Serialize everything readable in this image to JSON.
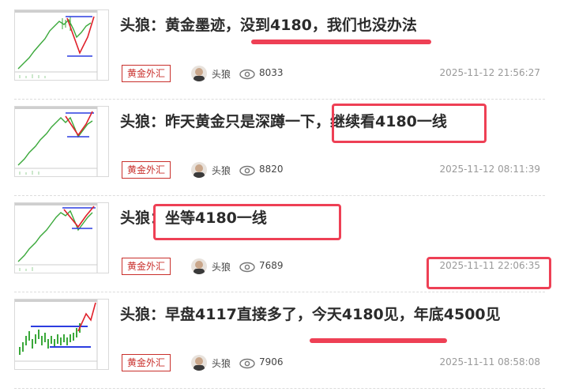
{
  "articles": [
    {
      "title": "头狼：黄金墨迹，没到4180，我们也没办法",
      "category": "黄金外汇",
      "author": "头狼",
      "views": "8033",
      "time": "2025-11-12 21:56:27"
    },
    {
      "title": "头狼：昨天黄金只是深蹲一下，继续看4180一线",
      "category": "黄金外汇",
      "author": "头狼",
      "views": "8820",
      "time": "2025-11-12 08:11:39"
    },
    {
      "title": "头狼：坐等4180一线",
      "category": "黄金外汇",
      "author": "头狼",
      "views": "7689",
      "time": "2025-11-11 22:06:35"
    },
    {
      "title": "头狼：早盘4117直接多了，今天4180见，年底4500见",
      "category": "黄金外汇",
      "author": "头狼",
      "views": "7906",
      "time": "2025-11-11 08:58:08"
    }
  ],
  "colors": {
    "annotation": "#ee4055",
    "tag": "#c9302c",
    "chart_up": "#3aa83a",
    "chart_line": "#2c3de0",
    "chart_arrow": "#e0202a"
  },
  "icons": [
    "eye-icon",
    "avatar",
    "chart-thumbnail"
  ]
}
